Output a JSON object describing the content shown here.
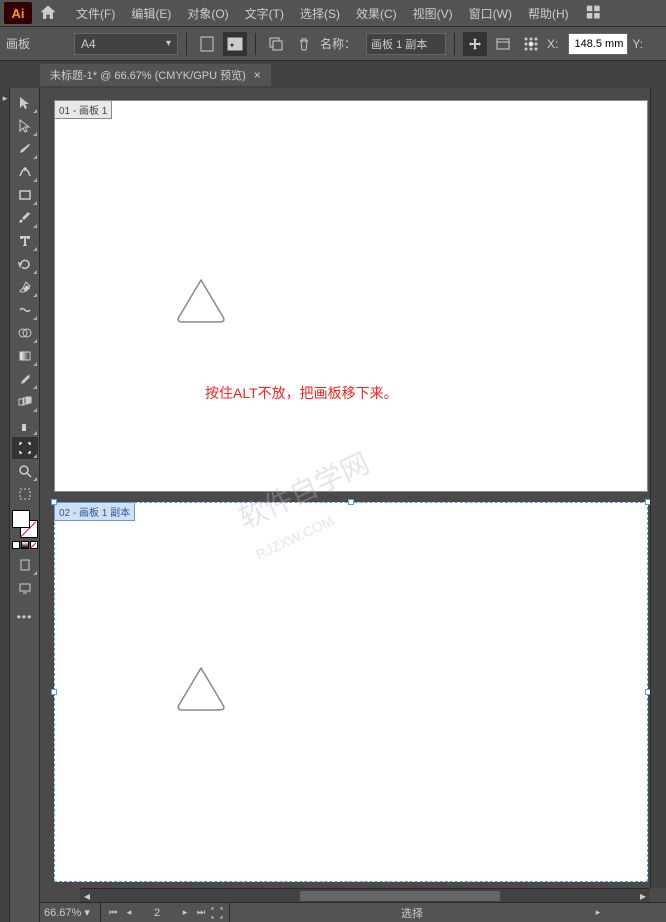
{
  "menu": {
    "items": [
      "文件(F)",
      "编辑(E)",
      "对象(O)",
      "文字(T)",
      "选择(S)",
      "效果(C)",
      "视图(V)",
      "窗口(W)",
      "帮助(H)"
    ]
  },
  "control": {
    "mode_label": "画板",
    "preset": "A4",
    "name_label": "名称：",
    "name_value": "画板 1 副本",
    "x_label": "X:",
    "x_value": "148.5 mm",
    "y_label": "Y:"
  },
  "tab": {
    "title": "未标题-1* @ 66.67% (CMYK/GPU 预览)"
  },
  "artboards": [
    {
      "label": "01 - 画板 1"
    },
    {
      "label": "02 - 画板 1 副本"
    }
  ],
  "instruction_text": "按住ALT不放，把画板移下来。",
  "status": {
    "zoom": "66.67%",
    "page": "2",
    "mode": "选择"
  },
  "tools": {
    "selection": "选择工具",
    "direct": "直接选择工具",
    "pen": "钢笔工具",
    "curvature": "曲率工具",
    "rect": "矩形工具",
    "brush": "画笔工具",
    "type": "文字工具",
    "rotate": "旋转工具",
    "eraser": "橡皮擦工具",
    "width": "宽度工具",
    "shapebuild": "形状生成器",
    "gradient": "渐变工具",
    "eyedrop": "吸管工具",
    "blend": "混合工具",
    "symbol": "符号喷枪",
    "artboard": "画板工具",
    "zoom": "缩放工具"
  }
}
